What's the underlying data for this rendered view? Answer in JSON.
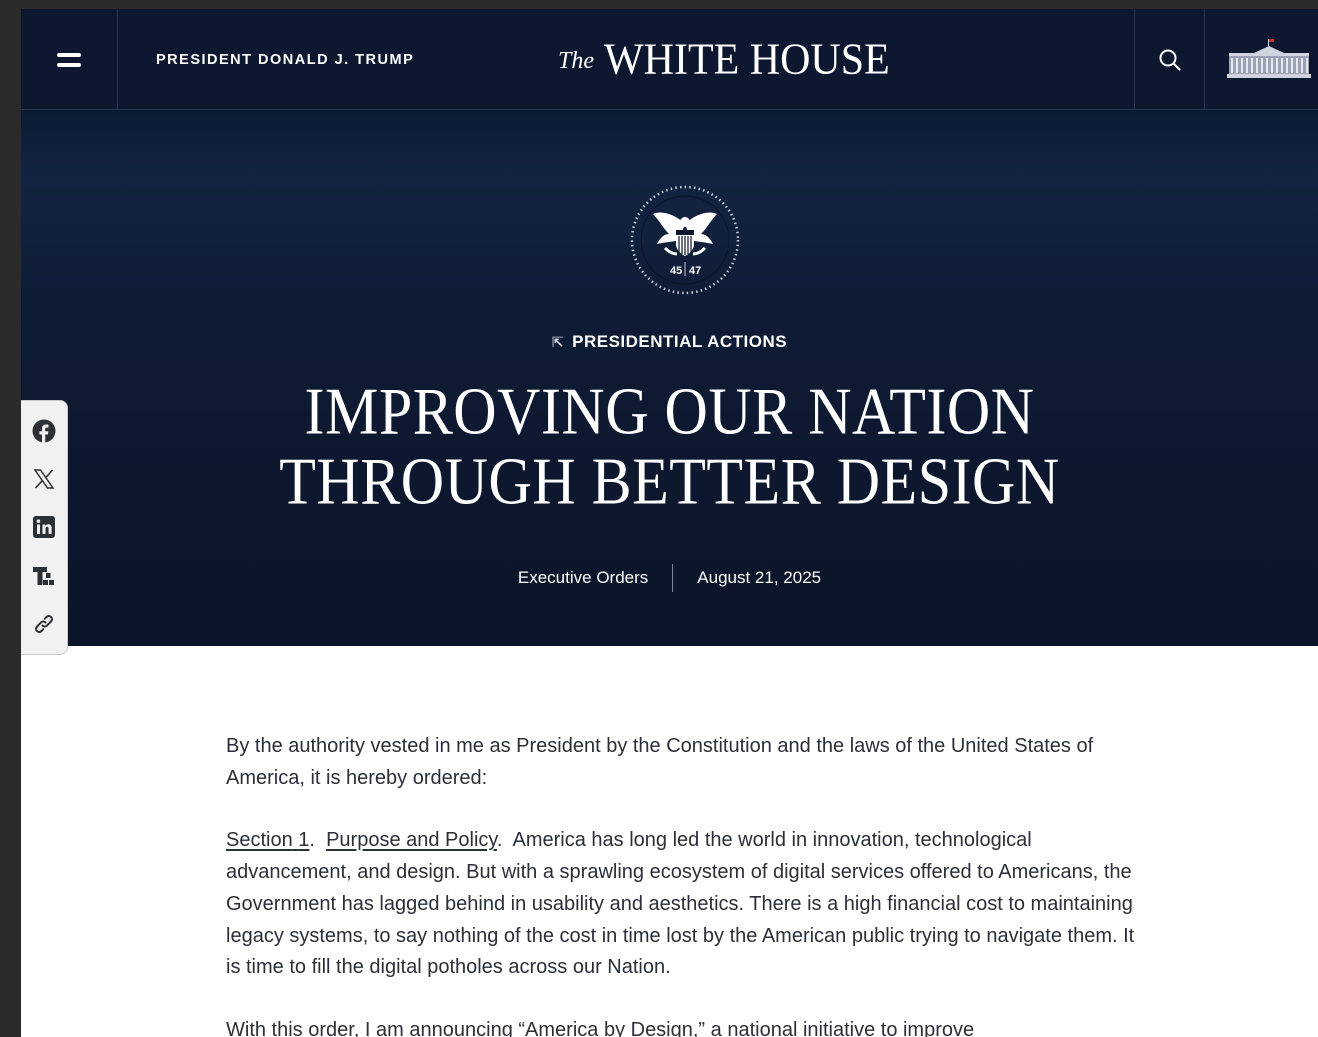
{
  "header": {
    "menu_icon": "hamburger-menu-icon",
    "president_label": "PRESIDENT DONALD J. TRUMP",
    "wordmark_the": "The",
    "wordmark_name": "WHITE HOUSE",
    "search_icon": "search-icon",
    "logo_icon": "white-house-building-icon"
  },
  "hero": {
    "seal_icon": "presidential-seal-icon",
    "seal_left_number": "45",
    "seal_right_number": "47",
    "category_arrow": "⇱",
    "category": "PRESIDENTIAL ACTIONS",
    "title_line1": "IMPROVING OUR NATION",
    "title_line2": "THROUGH BETTER DESIGN",
    "doc_type": "Executive Orders",
    "date": "August 21, 2025"
  },
  "share": {
    "items": [
      {
        "icon": "facebook-icon"
      },
      {
        "icon": "x-twitter-icon"
      },
      {
        "icon": "linkedin-icon"
      },
      {
        "icon": "truth-social-icon"
      },
      {
        "icon": "copy-link-icon"
      }
    ]
  },
  "article": {
    "intro": "By the authority vested in me as President by the Constitution and the laws of the United States of America, it is hereby ordered:",
    "section_label": "Section",
    "section_number": "1",
    "section_title": "Purpose and Policy",
    "section1_text": "America has long led the world in innovation, technological advancement, and design.  But with a sprawling ecosystem of digital services offered to Americans, the Government has lagged behind in usability and aesthetics.  There is a high financial cost to maintaining legacy systems, to say nothing of the cost in time lost by the American public trying to navigate them.  It is time to fill the digital potholes across our Nation.",
    "para3_start": "With this order, I am announcing “America by Design,” a national initiative to improve"
  },
  "colors": {
    "navy": "#0d1730",
    "text": "#2a2f38",
    "rail_bg": "#f1f1f1"
  }
}
